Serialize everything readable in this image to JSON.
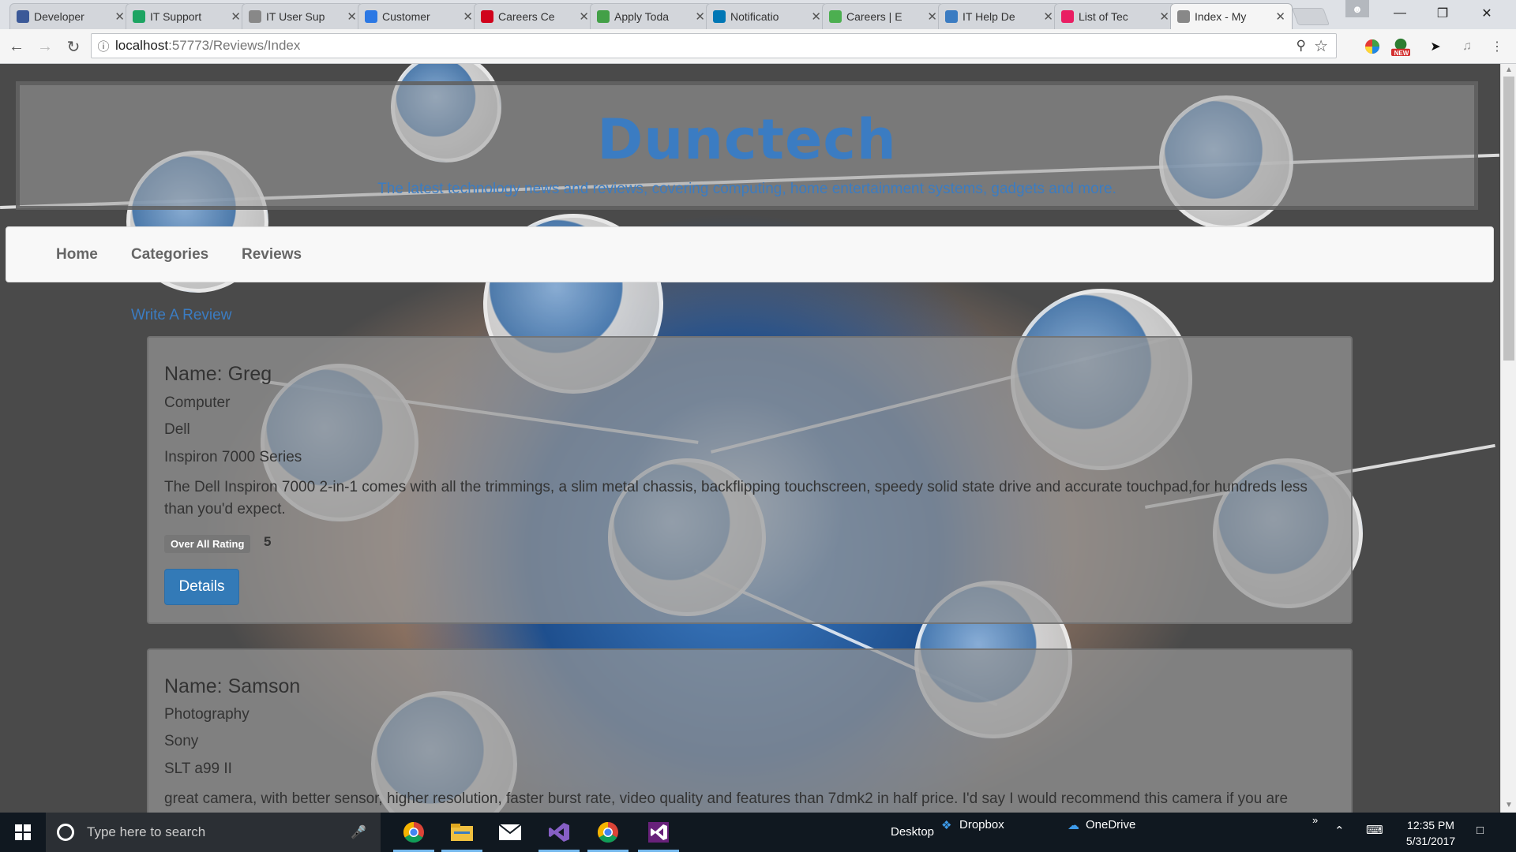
{
  "browser": {
    "tabs": [
      {
        "title": "Developer",
        "icon": "facebook-icon",
        "color": "#3b5998"
      },
      {
        "title": "IT Support",
        "icon": "doc-icon",
        "color": "#1da462"
      },
      {
        "title": "IT User Sup",
        "icon": "page-icon",
        "color": "#888888"
      },
      {
        "title": "Customer",
        "icon": "checkbox-icon",
        "color": "#2b78e4"
      },
      {
        "title": "Careers Ce",
        "icon": "info-icon",
        "color": "#d0021b"
      },
      {
        "title": "Apply Toda",
        "icon": "hyl-icon",
        "color": "#43a047"
      },
      {
        "title": "Notificatio",
        "icon": "linkedin-icon",
        "color": "#0077b5"
      },
      {
        "title": "Careers | E",
        "icon": "globe-icon",
        "color": "#4caf50"
      },
      {
        "title": "IT Help De",
        "icon": "w-icon",
        "color": "#3b7cc2"
      },
      {
        "title": "List of Tec",
        "icon": "chart-icon",
        "color": "#e91e63"
      },
      {
        "title": "Index - My",
        "icon": "page-icon",
        "color": "#888888"
      }
    ],
    "url_host": "localhost",
    "url_rest": ":57773/Reviews/Index",
    "ext_new_label": "NEW"
  },
  "site": {
    "brand": "Dunctech",
    "tagline": "The latest technology news and reviews, covering computing, home entertainment systems, gadgets and more.",
    "nav": [
      "Home",
      "Categories",
      "Reviews"
    ],
    "write_review": "Write A Review",
    "rating_label": "Over All Rating",
    "details_label": "Details"
  },
  "reviews": [
    {
      "name": "Name: Greg",
      "category": "Computer",
      "brand": "Dell",
      "model": "Inspiron 7000 Series",
      "text": "The Dell Inspiron 7000 2-in-1 comes with all the trimmings, a slim metal chassis, backflipping touchscreen, speedy solid state drive and accurate touchpad,for hundreds less than you'd expect.",
      "rating": "5"
    },
    {
      "name": "Name: Samson",
      "category": "Photography",
      "brand": "Sony",
      "model": "SLT a99 II",
      "text": "great camera, with better sensor, higher resolution, faster burst rate, video quality and features than 7dmk2 in half price. I'd say I would recommend this camera if you are"
    }
  ],
  "taskbar": {
    "search_placeholder": "Type here to search",
    "desktop_label": "Desktop",
    "dropbox_label": "Dropbox",
    "onedrive_label": "OneDrive",
    "time": "12:35 PM",
    "date": "5/31/2017"
  }
}
